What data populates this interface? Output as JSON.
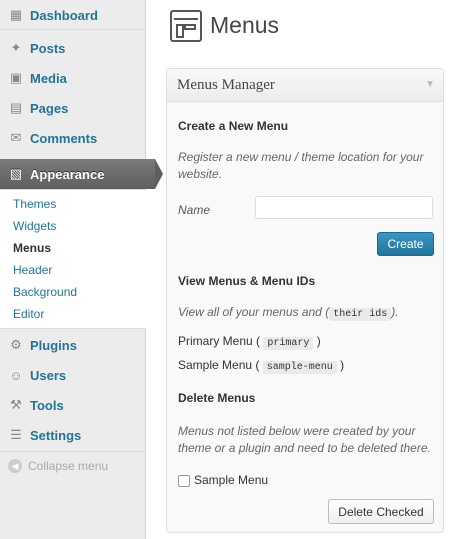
{
  "sidebar": {
    "items": [
      {
        "label": "Dashboard",
        "icon": "dashboard-icon",
        "glyph": "▦"
      },
      {
        "label": "Posts",
        "icon": "pin-icon",
        "glyph": "✦"
      },
      {
        "label": "Media",
        "icon": "media-icon",
        "glyph": "▣"
      },
      {
        "label": "Pages",
        "icon": "pages-icon",
        "glyph": "▤"
      },
      {
        "label": "Comments",
        "icon": "comment-icon",
        "glyph": "✉"
      },
      {
        "label": "Appearance",
        "icon": "appearance-icon",
        "glyph": "▧"
      },
      {
        "label": "Plugins",
        "icon": "plugin-icon",
        "glyph": "⚙"
      },
      {
        "label": "Users",
        "icon": "users-icon",
        "glyph": "☺"
      },
      {
        "label": "Tools",
        "icon": "tools-icon",
        "glyph": "⚒"
      },
      {
        "label": "Settings",
        "icon": "settings-icon",
        "glyph": "☰"
      }
    ],
    "submenu": [
      "Themes",
      "Widgets",
      "Menus",
      "Header",
      "Background",
      "Editor"
    ],
    "collapse_label": "Collapse menu"
  },
  "page": {
    "title": "Menus"
  },
  "manager": {
    "title": "Menus Manager",
    "create_title": "Create a New Menu",
    "create_desc": "Register a new menu / theme location for your website.",
    "name_label": "Name",
    "name_value": "",
    "create_button": "Create",
    "view_title": "View Menus & Menu IDs",
    "view_desc_prefix": "View all of your menus and (",
    "view_desc_code": "their ids",
    "view_desc_suffix": ").",
    "menus": [
      {
        "name": "Primary Menu",
        "id": "primary"
      },
      {
        "name": "Sample Menu",
        "id": "sample-menu"
      }
    ],
    "delete_title": "Delete Menus",
    "delete_desc": "Menus not listed below were created by your theme or a plugin and need to be deleted there.",
    "delete_items": [
      "Sample Menu"
    ],
    "delete_button": "Delete Checked"
  },
  "colors": {
    "link": "#21759b",
    "primary_button": "#21759b",
    "active_menu": "#6d6d6d"
  }
}
